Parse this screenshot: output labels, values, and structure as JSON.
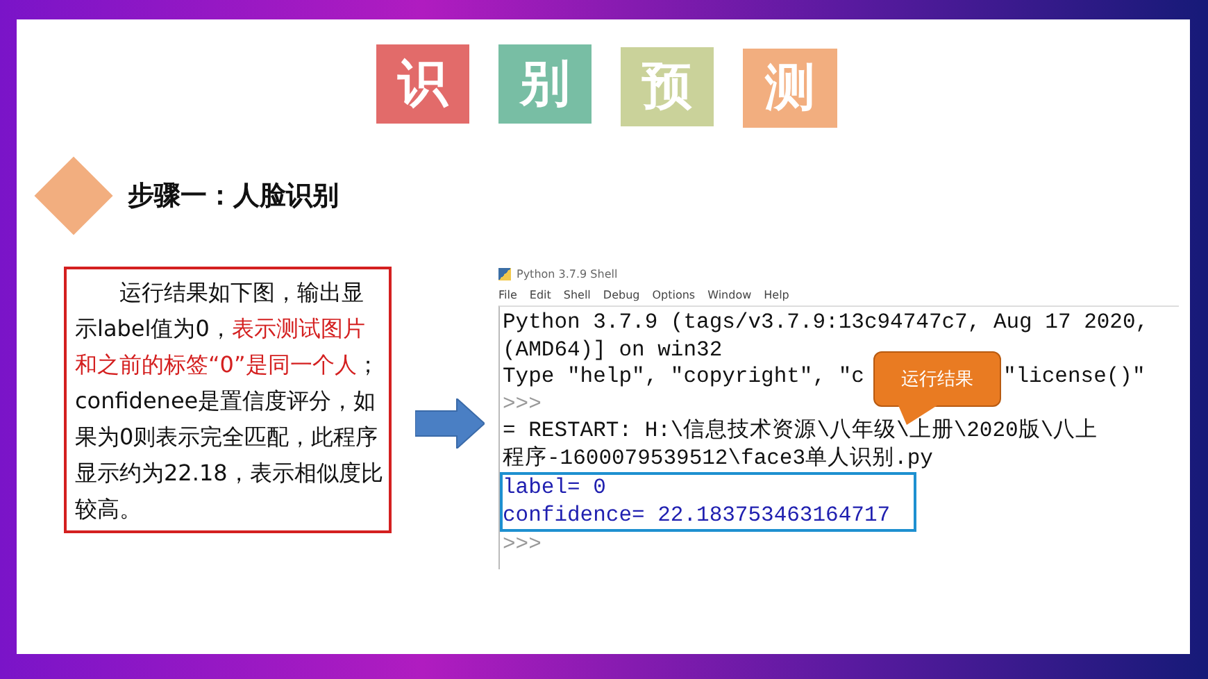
{
  "title_tiles": [
    {
      "text": "识",
      "color": "#e26b6a"
    },
    {
      "text": "别",
      "color": "#78bea4"
    },
    {
      "text": "预",
      "color": "#cad29a"
    },
    {
      "text": "测",
      "color": "#f2ae7f"
    }
  ],
  "heading": "步骤一：人脸识别",
  "description": [
    {
      "text": "运行结果如下图，输出显示label值为0，",
      "highlight": false
    },
    {
      "text": "表示测试图片和之前的标签“0”是同一个人",
      "highlight": true
    },
    {
      "text": "；confidenee是置信度评分，如果为0则表示完全匹配，此程序显示约为22.18，表示相似度比较高。",
      "highlight": false
    }
  ],
  "shell": {
    "title": "Python 3.7.9 Shell",
    "menu": [
      "File",
      "Edit",
      "Shell",
      "Debug",
      "Options",
      "Window",
      "Help"
    ],
    "lines": [
      {
        "kind": "output",
        "parts": [
          "Python 3.7.9 (tags/v3.7.9:13c94747c7, Aug 17 2020,"
        ]
      },
      {
        "kind": "output",
        "parts": [
          "(AMD64)] on win32"
        ]
      },
      {
        "kind": "output",
        "parts": [
          "Type \"help\", \"copyright\", \"c",
          "\"license()\""
        ]
      },
      {
        "kind": "prompt",
        "parts": [
          ">>>"
        ]
      },
      {
        "kind": "output",
        "parts": [
          "= RESTART: H:\\信息技术资源\\八年级\\上册\\2020版\\八上"
        ]
      },
      {
        "kind": "output",
        "parts": [
          "程序-1600079539512\\face3单人识别.py"
        ]
      },
      {
        "kind": "result",
        "parts": [
          "label= 0"
        ]
      },
      {
        "kind": "result",
        "parts": [
          "confidence= 22.183753463164717"
        ]
      },
      {
        "kind": "prompt",
        "parts": [
          ">>>"
        ]
      }
    ],
    "callout": "运行结果"
  }
}
